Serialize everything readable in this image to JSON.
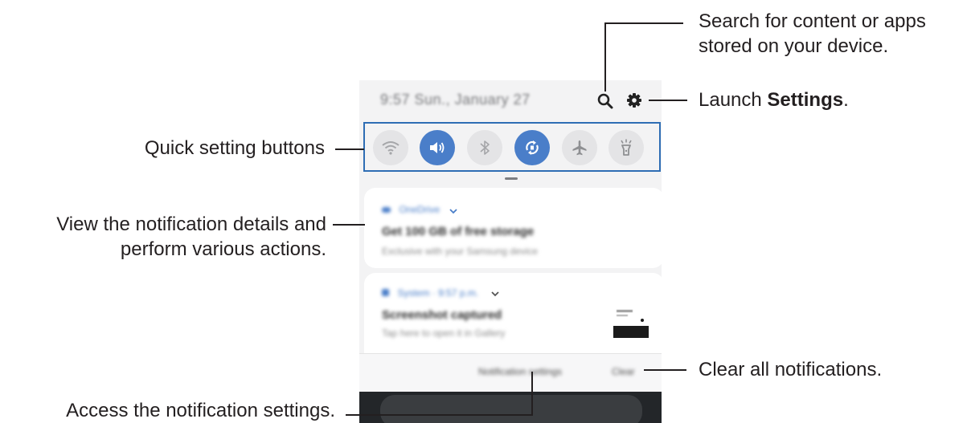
{
  "callouts": {
    "search": [
      "Search for content or apps",
      "stored on your device."
    ],
    "settings_pre": "Launch ",
    "settings_bold": "Settings",
    "settings_post": ".",
    "quick": "Quick setting buttons",
    "details": [
      "View the notification details and",
      "perform various actions."
    ],
    "clear": "Clear all notifications.",
    "access": "Access the notification settings."
  },
  "panel": {
    "status": "9:57  Sun., January 27",
    "quick_settings": [
      {
        "name": "wifi",
        "on": false
      },
      {
        "name": "sound",
        "on": true
      },
      {
        "name": "bluetooth",
        "on": false
      },
      {
        "name": "auto-rotate",
        "on": true
      },
      {
        "name": "airplane-mode",
        "on": false
      },
      {
        "name": "flashlight",
        "on": false
      }
    ],
    "notification1": {
      "app": "OneDrive",
      "title": "Get 100 GB of free storage",
      "subtitle": "Exclusive with your Samsung device"
    },
    "notification2": {
      "app": "System · 9:57 p.m.",
      "title": "Screenshot captured",
      "subtitle": "Tap here to open it in Gallery"
    },
    "notification_settings_label": "Notification settings",
    "clear_label": "Clear"
  },
  "colors": {
    "accent_border": "#2e6db4",
    "toggle_on": "#4a7ec9",
    "toggle_off": "#e4e4e6",
    "text": "#231f20"
  }
}
